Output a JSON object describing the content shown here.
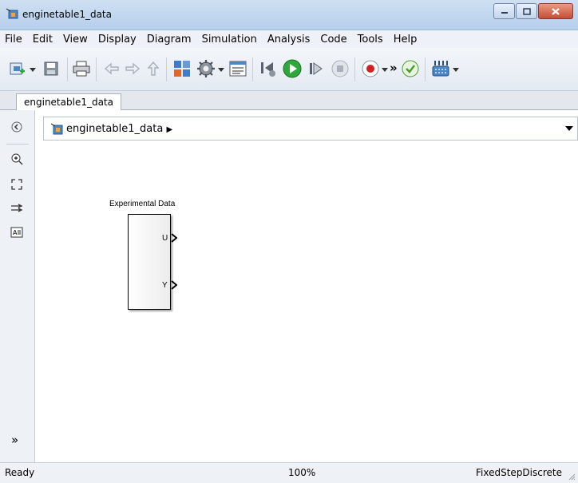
{
  "window": {
    "title": "enginetable1_data"
  },
  "menu": {
    "items": [
      "File",
      "Edit",
      "View",
      "Display",
      "Diagram",
      "Simulation",
      "Analysis",
      "Code",
      "Tools",
      "Help"
    ]
  },
  "toolbar": {
    "icons": [
      "new-model-icon",
      "save-icon",
      "print-icon",
      "back-icon",
      "forward-icon",
      "up-icon",
      "library-browser-icon",
      "config-params-icon",
      "model-explorer-icon",
      "step-back-icon",
      "run-icon",
      "step-forward-icon",
      "stop-icon",
      "record-icon",
      "overflow-icon",
      "check-icon",
      "build-icon"
    ],
    "overflow_label": "»"
  },
  "tabs": [
    {
      "label": "enginetable1_data"
    }
  ],
  "address": {
    "path": "enginetable1_data",
    "separator": "▶"
  },
  "palette": {
    "icons": [
      "hide-browser-icon",
      "zoom-in-icon",
      "fit-view-icon",
      "route-lines-icon",
      "annotation-icon",
      "expand-icon"
    ],
    "expand_label": "»"
  },
  "block": {
    "name": "Experimental Data",
    "ports": [
      "U",
      "Y"
    ]
  },
  "status": {
    "state": "Ready",
    "zoom": "100%",
    "solver": "FixedStepDiscrete"
  },
  "colors": {
    "titlebar": "#c3d7ef",
    "run_green": "#2fa83a",
    "record_red": "#d42020",
    "check_green": "#4a9c2a"
  }
}
